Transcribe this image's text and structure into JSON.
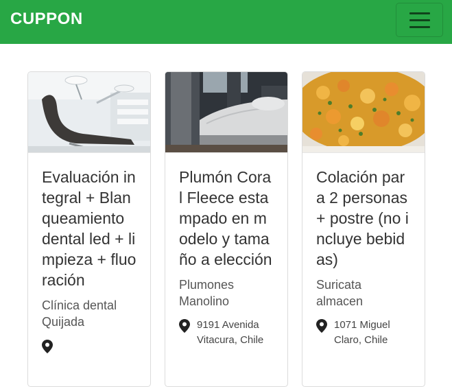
{
  "navbar": {
    "brand": "CUPPON",
    "brand_color": "#28a745"
  },
  "icons": {
    "menu": "hamburger-menu-icon",
    "location": "map-pin-icon"
  },
  "deals": [
    {
      "title": "Evaluación integral + Blanqueamiento dental led + limpieza + fluoración",
      "merchant": "Clínica dental Quijada",
      "address": "",
      "image": "dental-chair-photo"
    },
    {
      "title": "Plumón Coral Fleece estampado en modelo y tamaño a elección",
      "merchant": "Plumones Manolino",
      "address": "9191 Avenida Vitacura, Chile",
      "image": "bedroom-bed-photo"
    },
    {
      "title": "Colación para 2 personas + postre (no incluye bebidas)",
      "merchant": "Suricata almacen",
      "address": "1071 Miguel Claro, Chile",
      "image": "vegetable-stew-photo"
    }
  ]
}
